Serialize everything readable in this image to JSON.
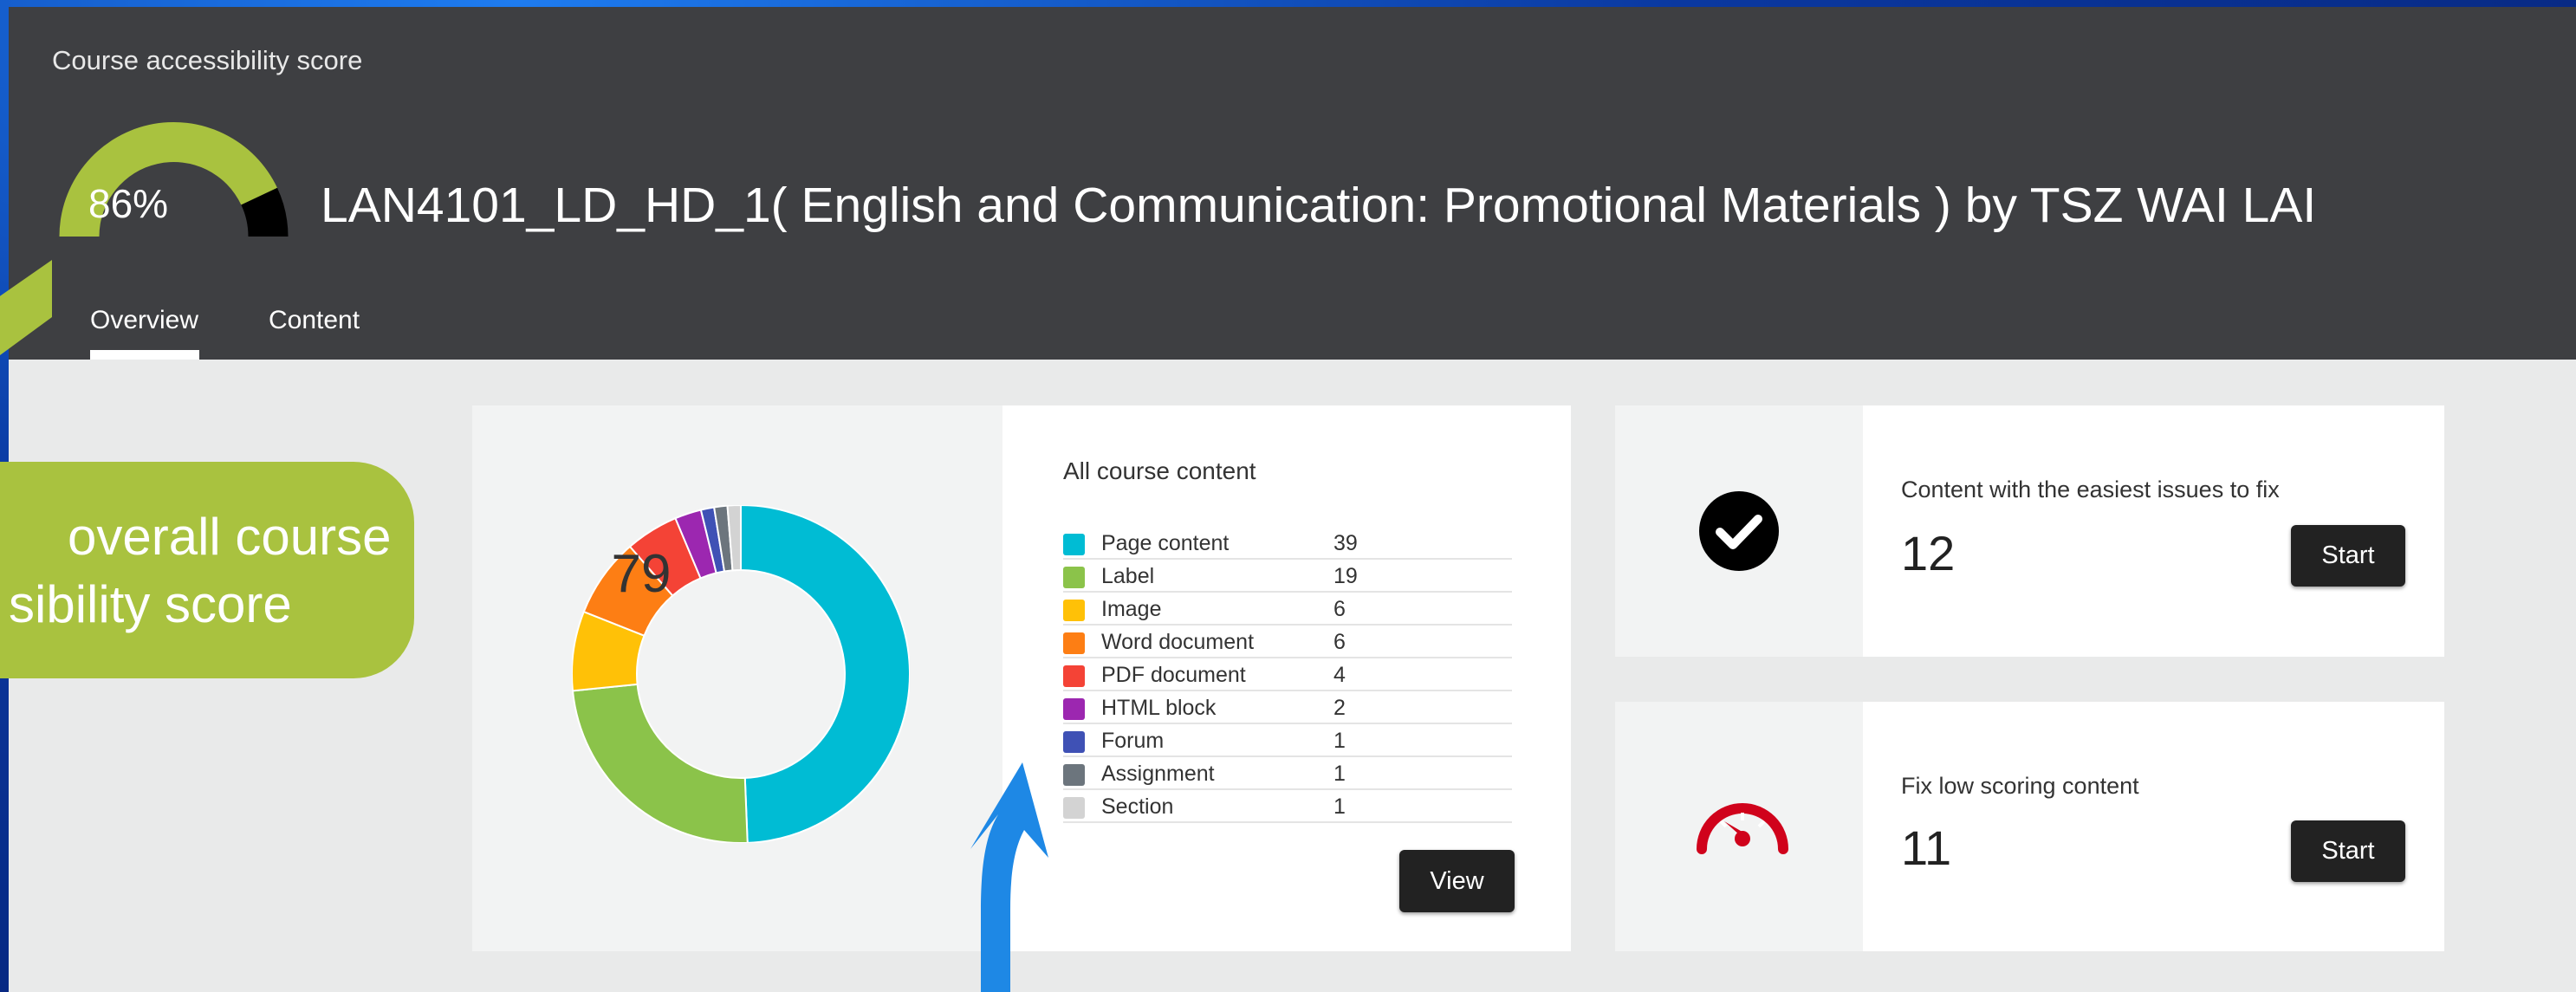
{
  "header": {
    "label": "Course accessibility score",
    "score_text": "86%",
    "score": 0.86,
    "course_title": "LAN4101_LD_HD_1( English and Communication: Promotional Materials ) by TSZ WAI LAI"
  },
  "tabs": [
    {
      "label": "Overview",
      "active": true
    },
    {
      "label": "Content",
      "active": false
    }
  ],
  "content_summary": {
    "title": "All course content",
    "total": "79",
    "items": [
      {
        "label": "Page content",
        "count": "39",
        "color": "#00bcd4"
      },
      {
        "label": "Label",
        "count": "19",
        "color": "#8bc34a"
      },
      {
        "label": "Image",
        "count": "6",
        "color": "#ffc107"
      },
      {
        "label": "Word document",
        "count": "6",
        "color": "#fd7e14"
      },
      {
        "label": "PDF document",
        "count": "4",
        "color": "#f44336"
      },
      {
        "label": "HTML block",
        "count": "2",
        "color": "#9c27b0"
      },
      {
        "label": "Forum",
        "count": "1",
        "color": "#3f51b5"
      },
      {
        "label": "Assignment",
        "count": "1",
        "color": "#6c757d"
      },
      {
        "label": "Section",
        "count": "1",
        "color": "#d3d3d3"
      }
    ],
    "view_label": "View"
  },
  "cards": {
    "easy": {
      "title": "Content with the easiest issues to fix",
      "count": "12",
      "button_label": "Start",
      "icon": "check-circle-icon"
    },
    "low": {
      "title": "Fix low scoring content",
      "count": "11",
      "button_label": "Start",
      "icon": "speedometer-icon",
      "icon_color": "#d0021b"
    }
  },
  "annotation": {
    "callout_line1": "overall course",
    "callout_line2": "sibility score",
    "callout_color": "#a9c23f",
    "arrow_color": "#1e88e5"
  },
  "chart_data": {
    "type": "pie",
    "donut": true,
    "center_label": "79",
    "categories": [
      "Page content",
      "Label",
      "Image",
      "Word document",
      "PDF document",
      "HTML block",
      "Forum",
      "Assignment",
      "Section"
    ],
    "values": [
      39,
      19,
      6,
      6,
      4,
      2,
      1,
      1,
      1
    ],
    "colors": [
      "#00bcd4",
      "#8bc34a",
      "#ffc107",
      "#fd7e14",
      "#f44336",
      "#9c27b0",
      "#3f51b5",
      "#6c757d",
      "#d3d3d3"
    ]
  }
}
